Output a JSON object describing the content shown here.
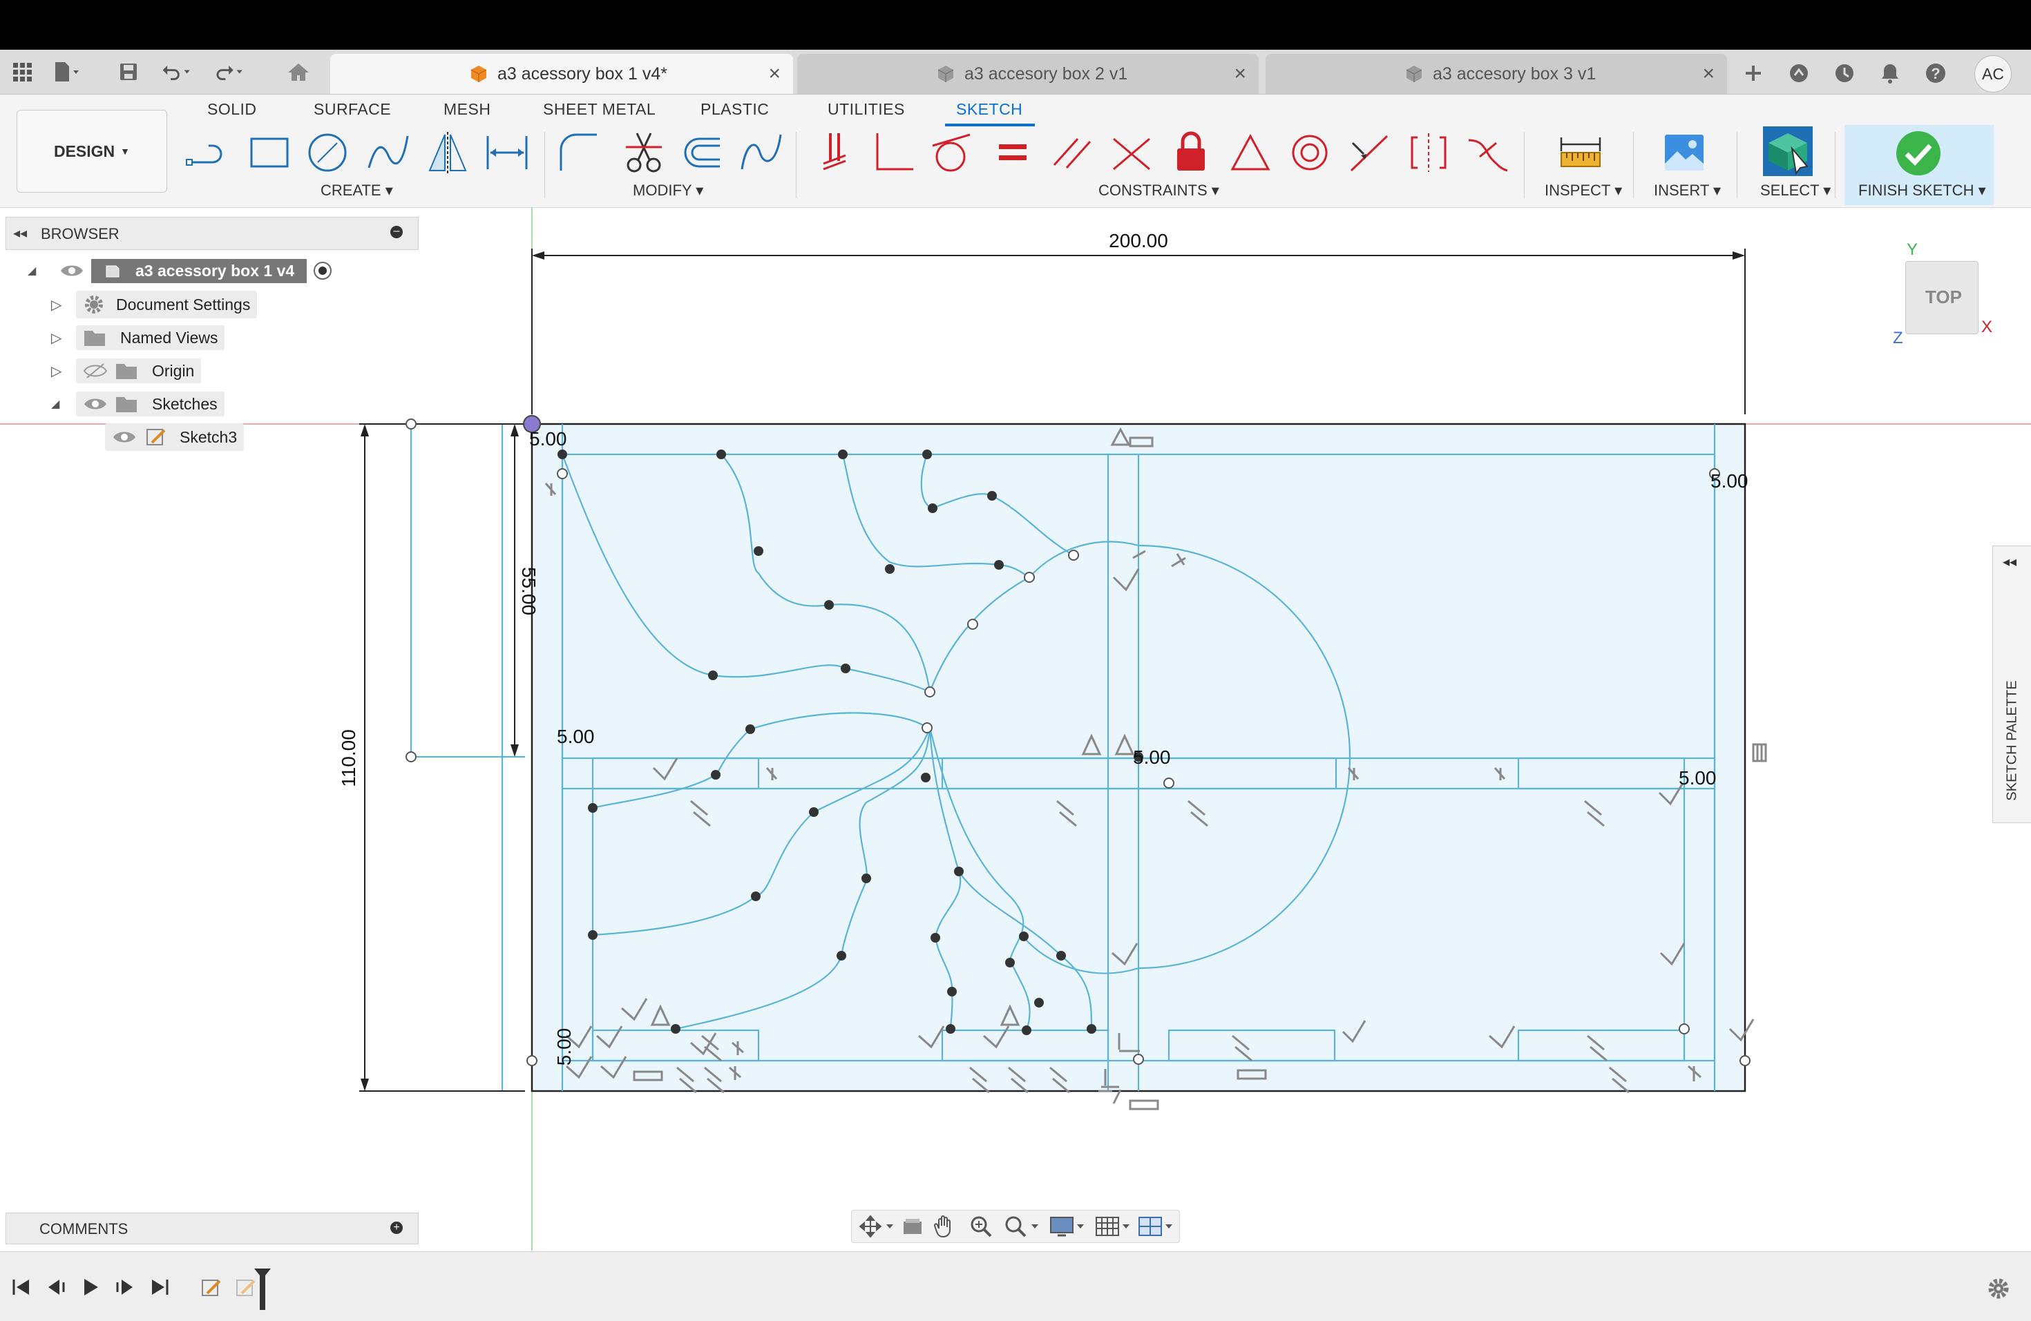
{
  "tabs": [
    {
      "title": "a3 acessory box 1 v4*",
      "active": true
    },
    {
      "title": "a3 accesory box 2 v1",
      "active": false
    },
    {
      "title": "a3 accesory box 3 v1",
      "active": false
    }
  ],
  "user_initials": "AC",
  "toolbar": {
    "workspace": "DESIGN",
    "product_tabs": [
      "SOLID",
      "SURFACE",
      "MESH",
      "SHEET METAL",
      "PLASTIC",
      "UTILITIES",
      "SKETCH"
    ],
    "selected_tab": "SKETCH",
    "groups": {
      "create": "CREATE",
      "modify": "MODIFY",
      "constraints": "CONSTRAINTS",
      "inspect": "INSPECT",
      "insert": "INSERT",
      "select": "SELECT",
      "finish": "FINISH SKETCH"
    }
  },
  "browser": {
    "title": "BROWSER",
    "root": "a3 acessory box 1 v4",
    "items": [
      "Document Settings",
      "Named Views",
      "Origin",
      "Sketches"
    ],
    "sketch": "Sketch3"
  },
  "comments": {
    "title": "COMMENTS"
  },
  "viewcube": {
    "face": "TOP",
    "axis_x": "X",
    "axis_y": "Y",
    "axis_z": "Z"
  },
  "sketch_palette": {
    "title": "SKETCH PALETTE"
  },
  "dimensions": {
    "width": "200.00",
    "height": "110.00",
    "half_height": "55.00",
    "offset_top_left": "5.00",
    "offset_top_right": "5.00",
    "offset_mid_left": "5.00",
    "offset_mid_center": "5.00",
    "offset_mid_right": "5.00",
    "offset_bottom_left": "5.00"
  },
  "colors": {
    "accent": "#0a6fd6",
    "sketch_line": "#5ab4d6",
    "sketch_fill": "#eaf6fc",
    "finish_check": "#3bb54a",
    "constraint_red": "#d0202a"
  }
}
